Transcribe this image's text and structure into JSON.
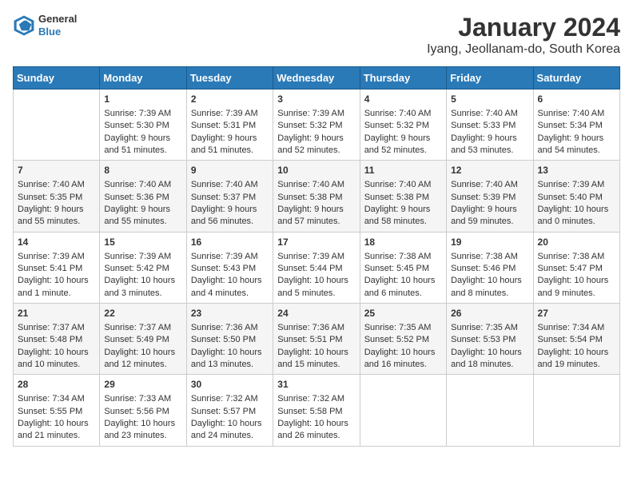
{
  "header": {
    "logo_line1": "General",
    "logo_line2": "Blue",
    "title": "January 2024",
    "subtitle": "Iyang, Jeollanam-do, South Korea"
  },
  "days_header": [
    "Sunday",
    "Monday",
    "Tuesday",
    "Wednesday",
    "Thursday",
    "Friday",
    "Saturday"
  ],
  "weeks": [
    [
      {
        "day": "",
        "info": ""
      },
      {
        "day": "1",
        "info": "Sunrise: 7:39 AM\nSunset: 5:30 PM\nDaylight: 9 hours\nand 51 minutes."
      },
      {
        "day": "2",
        "info": "Sunrise: 7:39 AM\nSunset: 5:31 PM\nDaylight: 9 hours\nand 51 minutes."
      },
      {
        "day": "3",
        "info": "Sunrise: 7:39 AM\nSunset: 5:32 PM\nDaylight: 9 hours\nand 52 minutes."
      },
      {
        "day": "4",
        "info": "Sunrise: 7:40 AM\nSunset: 5:32 PM\nDaylight: 9 hours\nand 52 minutes."
      },
      {
        "day": "5",
        "info": "Sunrise: 7:40 AM\nSunset: 5:33 PM\nDaylight: 9 hours\nand 53 minutes."
      },
      {
        "day": "6",
        "info": "Sunrise: 7:40 AM\nSunset: 5:34 PM\nDaylight: 9 hours\nand 54 minutes."
      }
    ],
    [
      {
        "day": "7",
        "info": "Sunrise: 7:40 AM\nSunset: 5:35 PM\nDaylight: 9 hours\nand 55 minutes."
      },
      {
        "day": "8",
        "info": "Sunrise: 7:40 AM\nSunset: 5:36 PM\nDaylight: 9 hours\nand 55 minutes."
      },
      {
        "day": "9",
        "info": "Sunrise: 7:40 AM\nSunset: 5:37 PM\nDaylight: 9 hours\nand 56 minutes."
      },
      {
        "day": "10",
        "info": "Sunrise: 7:40 AM\nSunset: 5:38 PM\nDaylight: 9 hours\nand 57 minutes."
      },
      {
        "day": "11",
        "info": "Sunrise: 7:40 AM\nSunset: 5:38 PM\nDaylight: 9 hours\nand 58 minutes."
      },
      {
        "day": "12",
        "info": "Sunrise: 7:40 AM\nSunset: 5:39 PM\nDaylight: 9 hours\nand 59 minutes."
      },
      {
        "day": "13",
        "info": "Sunrise: 7:39 AM\nSunset: 5:40 PM\nDaylight: 10 hours\nand 0 minutes."
      }
    ],
    [
      {
        "day": "14",
        "info": "Sunrise: 7:39 AM\nSunset: 5:41 PM\nDaylight: 10 hours\nand 1 minute."
      },
      {
        "day": "15",
        "info": "Sunrise: 7:39 AM\nSunset: 5:42 PM\nDaylight: 10 hours\nand 3 minutes."
      },
      {
        "day": "16",
        "info": "Sunrise: 7:39 AM\nSunset: 5:43 PM\nDaylight: 10 hours\nand 4 minutes."
      },
      {
        "day": "17",
        "info": "Sunrise: 7:39 AM\nSunset: 5:44 PM\nDaylight: 10 hours\nand 5 minutes."
      },
      {
        "day": "18",
        "info": "Sunrise: 7:38 AM\nSunset: 5:45 PM\nDaylight: 10 hours\nand 6 minutes."
      },
      {
        "day": "19",
        "info": "Sunrise: 7:38 AM\nSunset: 5:46 PM\nDaylight: 10 hours\nand 8 minutes."
      },
      {
        "day": "20",
        "info": "Sunrise: 7:38 AM\nSunset: 5:47 PM\nDaylight: 10 hours\nand 9 minutes."
      }
    ],
    [
      {
        "day": "21",
        "info": "Sunrise: 7:37 AM\nSunset: 5:48 PM\nDaylight: 10 hours\nand 10 minutes."
      },
      {
        "day": "22",
        "info": "Sunrise: 7:37 AM\nSunset: 5:49 PM\nDaylight: 10 hours\nand 12 minutes."
      },
      {
        "day": "23",
        "info": "Sunrise: 7:36 AM\nSunset: 5:50 PM\nDaylight: 10 hours\nand 13 minutes."
      },
      {
        "day": "24",
        "info": "Sunrise: 7:36 AM\nSunset: 5:51 PM\nDaylight: 10 hours\nand 15 minutes."
      },
      {
        "day": "25",
        "info": "Sunrise: 7:35 AM\nSunset: 5:52 PM\nDaylight: 10 hours\nand 16 minutes."
      },
      {
        "day": "26",
        "info": "Sunrise: 7:35 AM\nSunset: 5:53 PM\nDaylight: 10 hours\nand 18 minutes."
      },
      {
        "day": "27",
        "info": "Sunrise: 7:34 AM\nSunset: 5:54 PM\nDaylight: 10 hours\nand 19 minutes."
      }
    ],
    [
      {
        "day": "28",
        "info": "Sunrise: 7:34 AM\nSunset: 5:55 PM\nDaylight: 10 hours\nand 21 minutes."
      },
      {
        "day": "29",
        "info": "Sunrise: 7:33 AM\nSunset: 5:56 PM\nDaylight: 10 hours\nand 23 minutes."
      },
      {
        "day": "30",
        "info": "Sunrise: 7:32 AM\nSunset: 5:57 PM\nDaylight: 10 hours\nand 24 minutes."
      },
      {
        "day": "31",
        "info": "Sunrise: 7:32 AM\nSunset: 5:58 PM\nDaylight: 10 hours\nand 26 minutes."
      },
      {
        "day": "",
        "info": ""
      },
      {
        "day": "",
        "info": ""
      },
      {
        "day": "",
        "info": ""
      }
    ]
  ]
}
